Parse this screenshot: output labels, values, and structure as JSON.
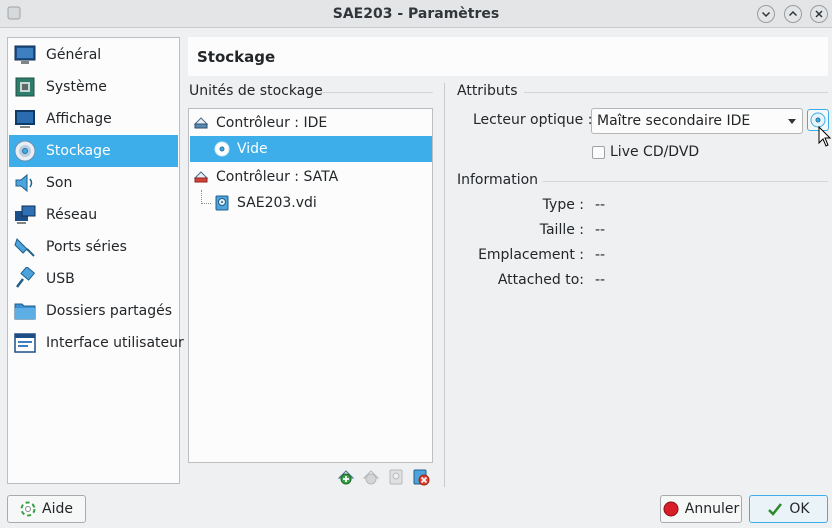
{
  "window": {
    "title": "SAE203 - Paramètres"
  },
  "categories": [
    {
      "label": "Général",
      "icon": "monitor-icon"
    },
    {
      "label": "Système",
      "icon": "motherboard-icon"
    },
    {
      "label": "Affichage",
      "icon": "display-icon"
    },
    {
      "label": "Stockage",
      "icon": "storage-disc-icon",
      "selected": true
    },
    {
      "label": "Son",
      "icon": "speaker-icon"
    },
    {
      "label": "Réseau",
      "icon": "network-icon"
    },
    {
      "label": "Ports séries",
      "icon": "serial-port-icon"
    },
    {
      "label": "USB",
      "icon": "usb-icon"
    },
    {
      "label": "Dossiers partagés",
      "icon": "folder-icon"
    },
    {
      "label": "Interface utilisateur",
      "icon": "user-interface-icon"
    }
  ],
  "page": {
    "title": "Stockage"
  },
  "storage": {
    "group_label": "Unités de stockage",
    "tree": [
      {
        "label": "Contrôleur : IDE",
        "type": "controller"
      },
      {
        "label": "Vide",
        "type": "optical",
        "selected": true
      },
      {
        "label": "Contrôleur : SATA",
        "type": "controller"
      },
      {
        "label": "SAE203.vdi",
        "type": "disk"
      }
    ]
  },
  "attributes": {
    "group_label": "Attributs",
    "optical_drive_label": "Lecteur optique :",
    "optical_drive_value": "Maître secondaire IDE",
    "live_cd_label": "Live CD/DVD",
    "live_cd_checked": false
  },
  "information": {
    "group_label": "Information",
    "rows": [
      {
        "label": "Type :",
        "value": "--"
      },
      {
        "label": "Taille :",
        "value": "--"
      },
      {
        "label": "Emplacement :",
        "value": "--"
      },
      {
        "label": "Attached to:",
        "value": "--"
      }
    ]
  },
  "buttons": {
    "help": "Aide",
    "cancel": "Annuler",
    "ok": "OK"
  },
  "colors": {
    "selection": "#3daee9",
    "cancel_icon": "#da1e28",
    "ok_icon": "#2c8a2c"
  }
}
